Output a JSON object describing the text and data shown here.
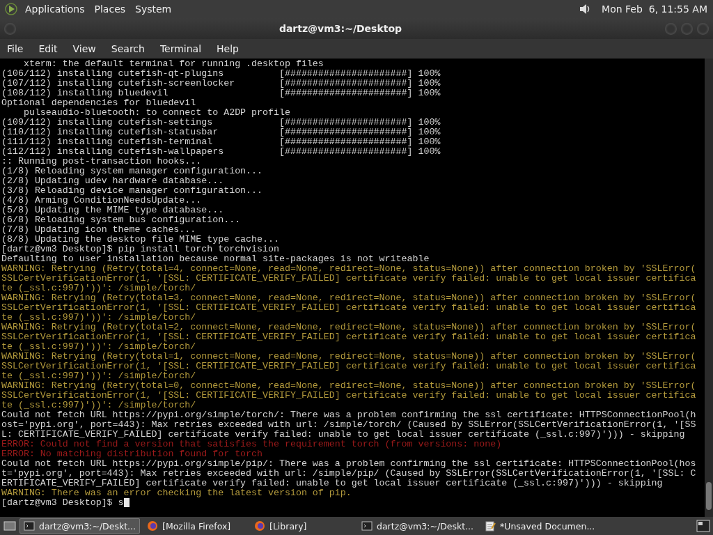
{
  "top_panel": {
    "menus": [
      "Applications",
      "Places",
      "System"
    ],
    "clock": "Mon Feb  6, 11:55 AM"
  },
  "window": {
    "title": "dartz@vm3:~/Desktop"
  },
  "menu_bar": [
    "File",
    "Edit",
    "View",
    "Search",
    "Terminal",
    "Help"
  ],
  "terminal": {
    "lines": [
      {
        "kind": "normal",
        "text": "    xterm: the default terminal for running .desktop files"
      },
      {
        "kind": "normal",
        "text": "(106/112) installing cutefish-qt-plugins          [######################] 100%"
      },
      {
        "kind": "normal",
        "text": "(107/112) installing cutefish-screenlocker        [######################] 100%"
      },
      {
        "kind": "normal",
        "text": "(108/112) installing bluedevil                    [######################] 100%"
      },
      {
        "kind": "normal",
        "text": "Optional dependencies for bluedevil"
      },
      {
        "kind": "normal",
        "text": "    pulseaudio-bluetooth: to connect to A2DP profile"
      },
      {
        "kind": "normal",
        "text": "(109/112) installing cutefish-settings            [######################] 100%"
      },
      {
        "kind": "normal",
        "text": "(110/112) installing cutefish-statusbar           [######################] 100%"
      },
      {
        "kind": "normal",
        "text": "(111/112) installing cutefish-terminal            [######################] 100%"
      },
      {
        "kind": "normal",
        "text": "(112/112) installing cutefish-wallpapers          [######################] 100%"
      },
      {
        "kind": "normal",
        "text": ":: Running post-transaction hooks..."
      },
      {
        "kind": "normal",
        "text": "(1/8) Reloading system manager configuration..."
      },
      {
        "kind": "normal",
        "text": "(2/8) Updating udev hardware database..."
      },
      {
        "kind": "normal",
        "text": "(3/8) Reloading device manager configuration..."
      },
      {
        "kind": "normal",
        "text": "(4/8) Arming ConditionNeedsUpdate..."
      },
      {
        "kind": "normal",
        "text": "(5/8) Updating the MIME type database..."
      },
      {
        "kind": "normal",
        "text": "(6/8) Reloading system bus configuration..."
      },
      {
        "kind": "normal",
        "text": "(7/8) Updating icon theme caches..."
      },
      {
        "kind": "normal",
        "text": "(8/8) Updating the desktop file MIME type cache..."
      },
      {
        "kind": "normal",
        "text": "[dartz@vm3 Desktop]$ pip install torch torchvision"
      },
      {
        "kind": "normal",
        "text": "Defaulting to user installation because normal site-packages is not writeable"
      },
      {
        "kind": "warning",
        "text": "WARNING: Retrying (Retry(total=4, connect=None, read=None, redirect=None, status=None)) after connection broken by 'SSLError("
      },
      {
        "kind": "warning",
        "text": "SSLCertVerificationError(1, '[SSL: CERTIFICATE_VERIFY_FAILED] certificate verify failed: unable to get local issuer certifica"
      },
      {
        "kind": "warning",
        "text": "te (_ssl.c:997)'))': /simple/torch/"
      },
      {
        "kind": "warning",
        "text": "WARNING: Retrying (Retry(total=3, connect=None, read=None, redirect=None, status=None)) after connection broken by 'SSLError("
      },
      {
        "kind": "warning",
        "text": "SSLCertVerificationError(1, '[SSL: CERTIFICATE_VERIFY_FAILED] certificate verify failed: unable to get local issuer certifica"
      },
      {
        "kind": "warning",
        "text": "te (_ssl.c:997)'))': /simple/torch/"
      },
      {
        "kind": "warning",
        "text": "WARNING: Retrying (Retry(total=2, connect=None, read=None, redirect=None, status=None)) after connection broken by 'SSLError("
      },
      {
        "kind": "warning",
        "text": "SSLCertVerificationError(1, '[SSL: CERTIFICATE_VERIFY_FAILED] certificate verify failed: unable to get local issuer certifica"
      },
      {
        "kind": "warning",
        "text": "te (_ssl.c:997)'))': /simple/torch/"
      },
      {
        "kind": "warning",
        "text": "WARNING: Retrying (Retry(total=1, connect=None, read=None, redirect=None, status=None)) after connection broken by 'SSLError("
      },
      {
        "kind": "warning",
        "text": "SSLCertVerificationError(1, '[SSL: CERTIFICATE_VERIFY_FAILED] certificate verify failed: unable to get local issuer certifica"
      },
      {
        "kind": "warning",
        "text": "te (_ssl.c:997)'))': /simple/torch/"
      },
      {
        "kind": "warning",
        "text": "WARNING: Retrying (Retry(total=0, connect=None, read=None, redirect=None, status=None)) after connection broken by 'SSLError("
      },
      {
        "kind": "warning",
        "text": "SSLCertVerificationError(1, '[SSL: CERTIFICATE_VERIFY_FAILED] certificate verify failed: unable to get local issuer certifica"
      },
      {
        "kind": "warning",
        "text": "te (_ssl.c:997)'))': /simple/torch/"
      },
      {
        "kind": "normal",
        "text": "Could not fetch URL https://pypi.org/simple/torch/: There was a problem confirming the ssl certificate: HTTPSConnectionPool(h"
      },
      {
        "kind": "normal",
        "text": "ost='pypi.org', port=443): Max retries exceeded with url: /simple/torch/ (Caused by SSLError(SSLCertVerificationError(1, '[SS"
      },
      {
        "kind": "normal",
        "text": "L: CERTIFICATE_VERIFY_FAILED] certificate verify failed: unable to get local issuer certificate (_ssl.c:997)'))) - skipping"
      },
      {
        "kind": "error",
        "text": "ERROR: Could not find a version that satisfies the requirement torch (from versions: none)"
      },
      {
        "kind": "error",
        "text": "ERROR: No matching distribution found for torch"
      },
      {
        "kind": "normal",
        "text": "Could not fetch URL https://pypi.org/simple/pip/: There was a problem confirming the ssl certificate: HTTPSConnectionPool(hos"
      },
      {
        "kind": "normal",
        "text": "t='pypi.org', port=443): Max retries exceeded with url: /simple/pip/ (Caused by SSLError(SSLCertVerificationError(1, '[SSL: C"
      },
      {
        "kind": "normal",
        "text": "ERTIFICATE_VERIFY_FAILED] certificate verify failed: unable to get local issuer certificate (_ssl.c:997)'))) - skipping"
      },
      {
        "kind": "warning",
        "text": "WARNING: There was an error checking the latest version of pip."
      }
    ],
    "prompt": "[dartz@vm3 Desktop]$ s"
  },
  "taskbar": {
    "items": [
      {
        "kind": "terminal",
        "label": "dartz@vm3:~/Deskt...",
        "selected": true
      },
      {
        "kind": "browser",
        "label": "[Mozilla Firefox]",
        "selected": false
      },
      {
        "kind": "browser",
        "label": "[Library]",
        "selected": false
      },
      {
        "kind": "terminal",
        "label": "dartz@vm3:~/Deskt...",
        "selected": false
      },
      {
        "kind": "editor",
        "label": "*Unsaved Documen...",
        "selected": false
      }
    ]
  }
}
